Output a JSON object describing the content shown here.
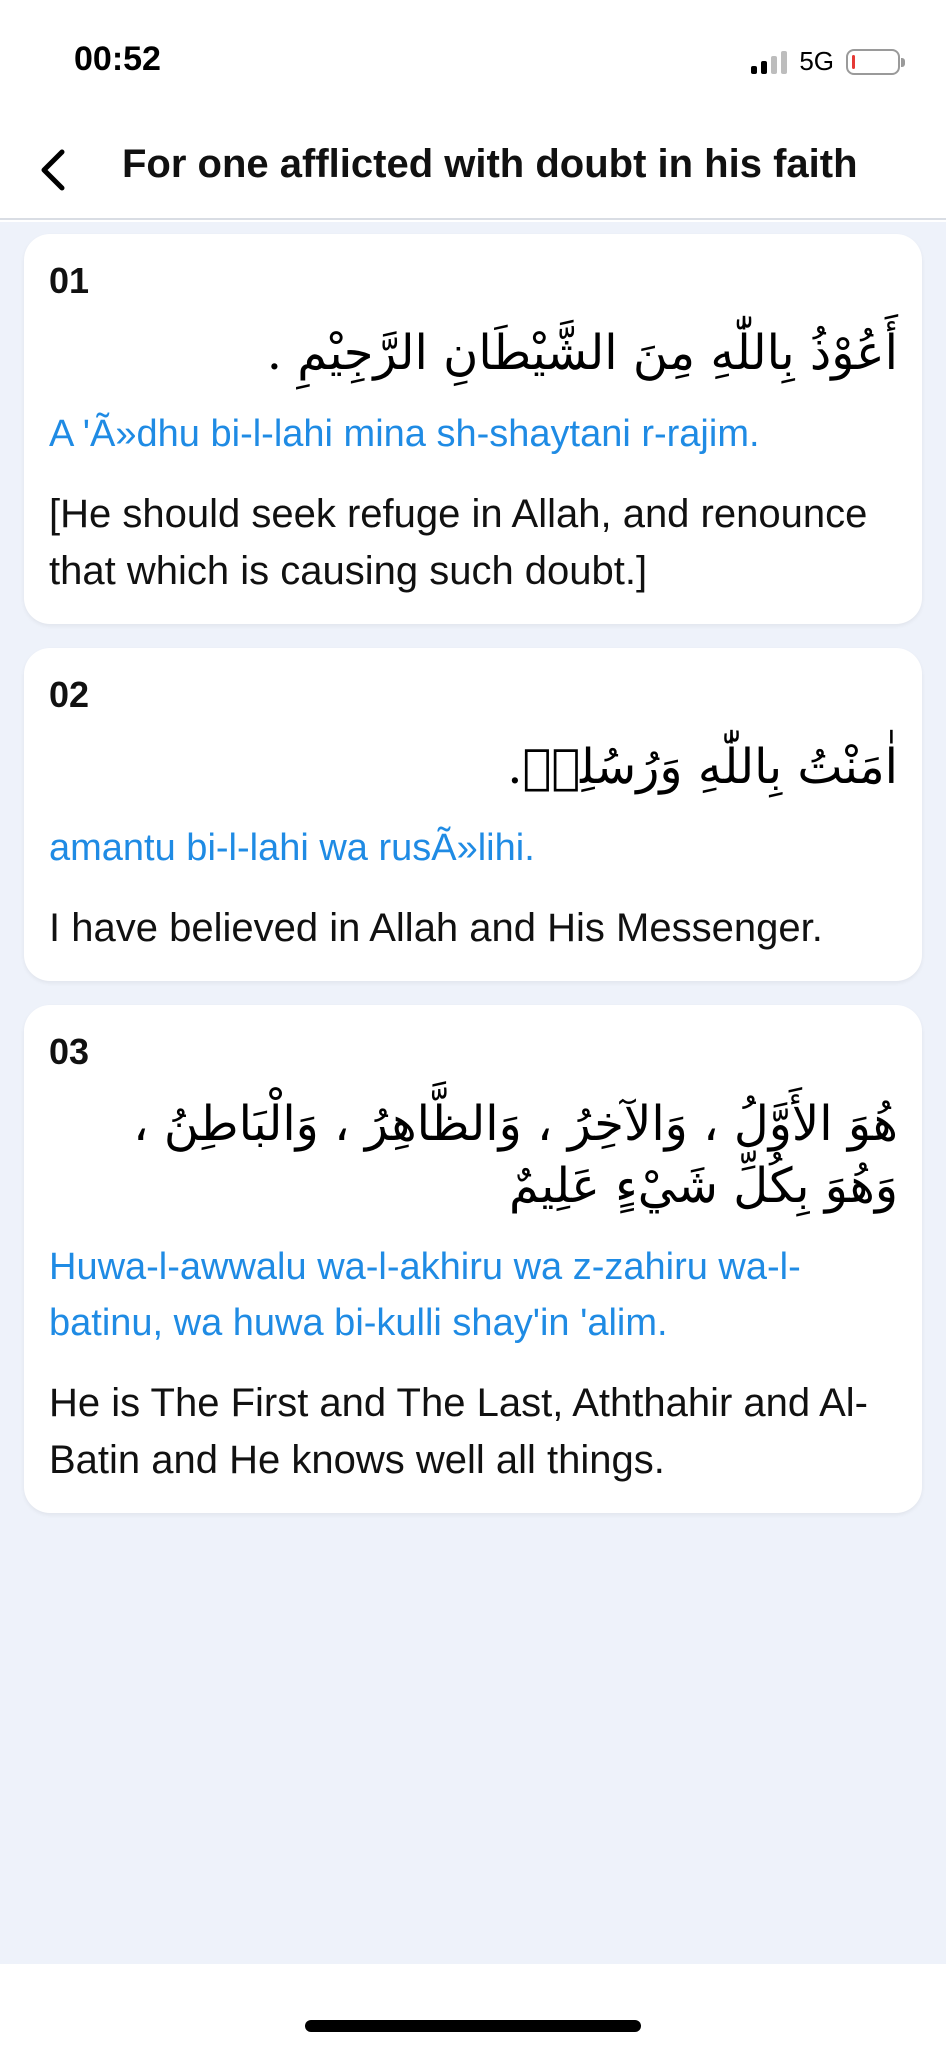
{
  "status_bar": {
    "time": "00:52",
    "network": "5G",
    "signal_bars_active": 2,
    "signal_bars_total": 4,
    "battery_level": 0.05,
    "battery_color": "#e53935"
  },
  "header": {
    "back_icon": "chevron-left-icon",
    "title": "For one afflicted with doubt in his faith"
  },
  "colors": {
    "accent": "#1f8be4",
    "background": "#eef2fa",
    "card": "#ffffff"
  },
  "entries": [
    {
      "number": "01",
      "arabic": "أَعُوْذُ بِاللّٰهِ مِنَ الشَّيْطَانِ الرَّجِيْمِ .",
      "transliteration": "A 'Ã»dhu bi-l-lahi mina sh-shaytani r-rajim.",
      "translation": "[He should seek refuge in Allah, and renounce that which is causing such doubt.]"
    },
    {
      "number": "02",
      "arabic": "اٰمَنْتُ بِاللّٰهِ وَرُسُلِهٖ.",
      "transliteration": "amantu bi-l-lahi wa rusÃ»lihi.",
      "translation": "I have believed in Allah and His Messenger."
    },
    {
      "number": "03",
      "arabic": "هُوَ الأَوَّلُ ، وَالآخِرُ ، وَالظَّاهِرُ ، وَالْبَاطِنُ ، وَهُوَ بِكُلِّ شَيْءٍ عَلِيمٌ",
      "transliteration": "Huwa-l-awwalu wa-l-akhiru wa z-zahiru wa-l-batinu, wa huwa bi-kulli shay'in 'alim.",
      "translation": "He is The First and The Last, Aththahir and Al-Batin and He knows well all things."
    }
  ]
}
